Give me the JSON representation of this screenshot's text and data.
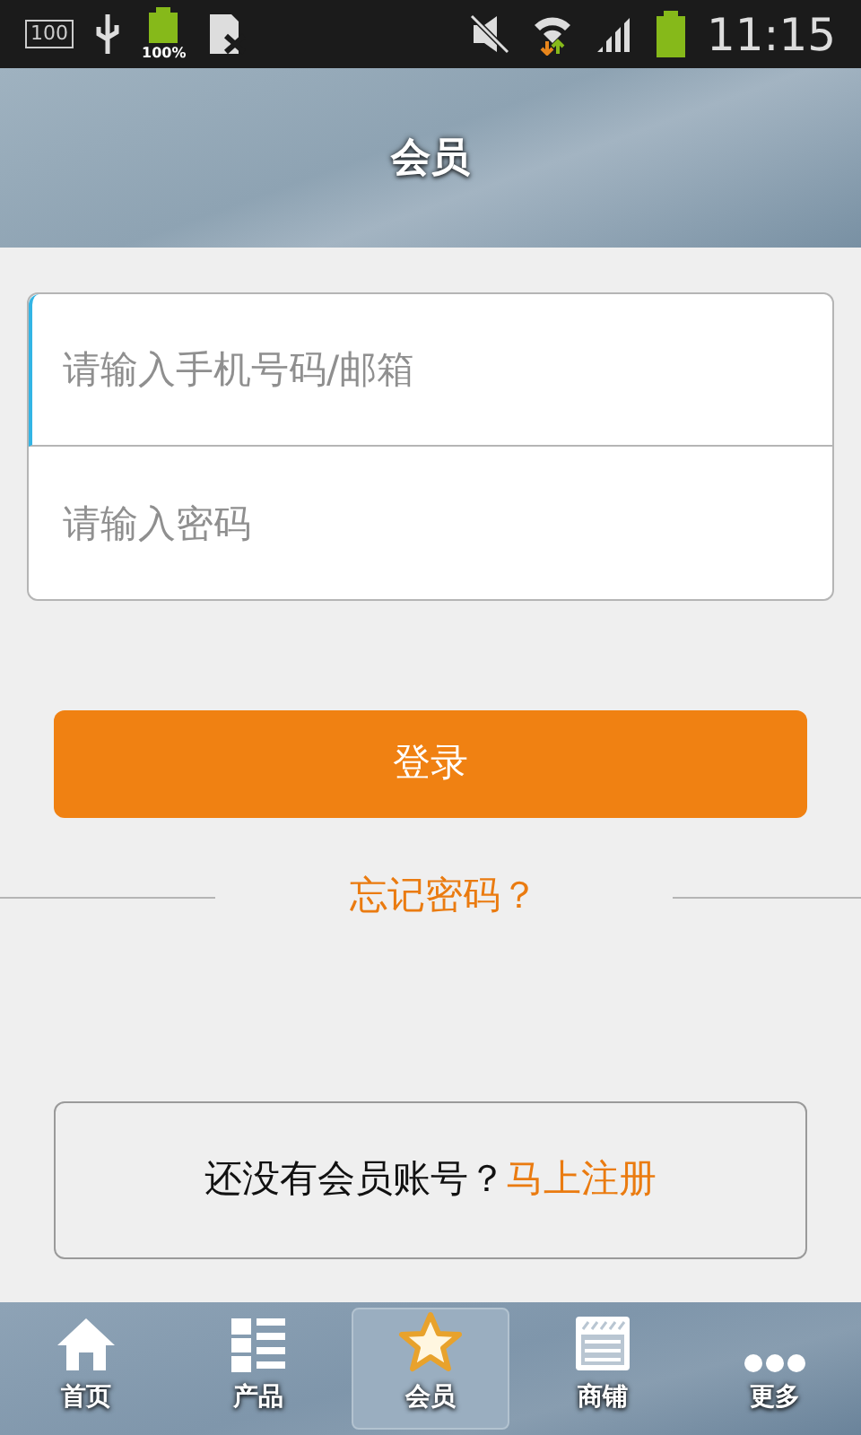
{
  "status_bar": {
    "storage": "100",
    "battery_small": "100%",
    "time": "11:15"
  },
  "header": {
    "title": "会员"
  },
  "login_form": {
    "fields": [
      {
        "placeholder": "请输入手机号码/邮箱",
        "focused": true
      },
      {
        "placeholder": "请输入密码",
        "focused": false
      }
    ],
    "login_button": "登录",
    "forgot_password": "忘记密码？"
  },
  "register": {
    "prompt": "还没有会员账号？",
    "link": "马上注册"
  },
  "bottom_nav": [
    {
      "label": "首页",
      "selected": false
    },
    {
      "label": "产品",
      "selected": false
    },
    {
      "label": "会员",
      "selected": true
    },
    {
      "label": "商铺",
      "selected": false
    },
    {
      "label": "更多",
      "selected": false
    }
  ]
}
